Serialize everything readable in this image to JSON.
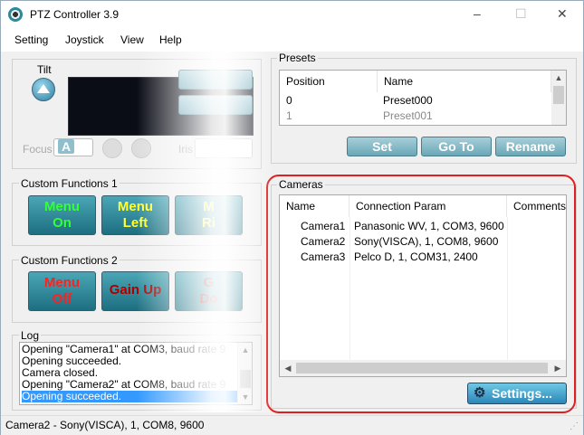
{
  "window": {
    "title": "PTZ Controller 3.9",
    "minimize": "–",
    "maximize": "☐",
    "close": "✕"
  },
  "menu": [
    "Setting",
    "Joystick",
    "View",
    "Help"
  ],
  "ptz": {
    "tilt_label": "Tilt",
    "focus_label": "Focus",
    "focus_auto": "A",
    "iris_label": "Iris"
  },
  "custom1": {
    "label": "Custom Functions 1",
    "buttons": [
      {
        "l1": "Menu",
        "l2": "On",
        "color": "#33ff33"
      },
      {
        "l1": "Menu",
        "l2": "Left",
        "color": "#ffff33"
      },
      {
        "l1": "M",
        "l2": "Ri",
        "color": "#ffff33"
      }
    ]
  },
  "custom2": {
    "label": "Custom Functions 2",
    "buttons": [
      {
        "l1": "Menu",
        "l2": "Off",
        "color": "#ff2020"
      },
      {
        "l1": "Gain Up",
        "l2": "",
        "color": "#aa0000"
      },
      {
        "l1": "G",
        "l2": "Do",
        "color": "#aa0000"
      }
    ]
  },
  "log": {
    "label": "Log",
    "lines": [
      "Opening \"Camera1\" at COM3, baud rate 9",
      "Opening succeeded.",
      "Camera closed.",
      "Opening \"Camera2\" at COM8, baud rate 9",
      "Opening succeeded."
    ]
  },
  "presets": {
    "label": "Presets",
    "headers": [
      "Position",
      "Name"
    ],
    "rows": [
      [
        "0",
        "Preset000"
      ],
      [
        "1",
        "Preset001"
      ]
    ],
    "buttons": [
      "Set",
      "Go To",
      "Rename"
    ]
  },
  "cameras": {
    "label": "Cameras",
    "headers": [
      "Name",
      "Connection Param",
      "Comments"
    ],
    "rows": [
      [
        "Camera1",
        "Panasonic WV, 1, COM3, 9600"
      ],
      [
        "Camera2",
        "Sony(VISCA), 1, COM8, 9600"
      ],
      [
        "Camera3",
        "Pelco D, 1, COM31, 2400"
      ]
    ],
    "settings_button": "Settings..."
  },
  "status": {
    "text": "Camera2 - Sony(VISCA), 1, COM8, 9600"
  }
}
